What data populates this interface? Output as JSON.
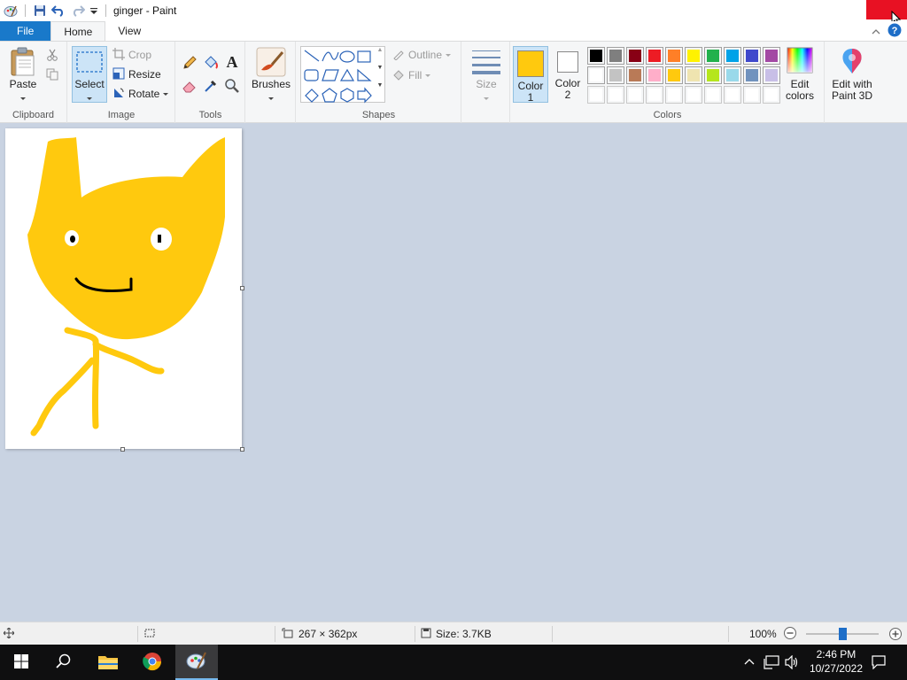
{
  "window": {
    "title": "ginger - Paint"
  },
  "tabs": [
    {
      "label": "File"
    },
    {
      "label": "Home"
    },
    {
      "label": "View"
    }
  ],
  "ribbon": {
    "clipboard": {
      "label": "Clipboard",
      "paste": "Paste"
    },
    "image": {
      "label": "Image",
      "select": "Select",
      "crop": "Crop",
      "resize": "Resize",
      "rotate": "Rotate"
    },
    "tools": {
      "label": "Tools"
    },
    "brushes": {
      "label": "Brushes"
    },
    "shapes": {
      "label": "Shapes",
      "outline": "Outline",
      "fill": "Fill"
    },
    "size": {
      "label": "Size"
    },
    "colors": {
      "label": "Colors",
      "color1": "Color 1",
      "color1_a": "Color",
      "color1_b": "1",
      "color2_a": "Color",
      "color2_b": "2",
      "color1_value": "#ffc90e",
      "color2_value": "#ffffff",
      "edit_a": "Edit",
      "edit_b": "colors",
      "paint3d_a": "Edit with",
      "paint3d_b": "Paint 3D",
      "palette_row1": [
        "#000000",
        "#7f7f7f",
        "#880015",
        "#ed1c24",
        "#ff7f27",
        "#fff200",
        "#22b14c",
        "#00a2e8",
        "#3f48cc",
        "#a349a4"
      ],
      "palette_row2": [
        "#ffffff",
        "#c3c3c3",
        "#b97a57",
        "#ffaec9",
        "#ffc90e",
        "#efe4b0",
        "#b5e61d",
        "#99d9ea",
        "#7092be",
        "#c8bfe7"
      ],
      "palette_row3": [
        "#ffffff",
        "#ffffff",
        "#ffffff",
        "#ffffff",
        "#ffffff",
        "#ffffff",
        "#ffffff",
        "#ffffff",
        "#ffffff",
        "#ffffff"
      ]
    }
  },
  "drawing": {
    "fill_color": "#ffc90e",
    "stroke_color": "#000000"
  },
  "status": {
    "dimensions": "267 × 362px",
    "size": "Size: 3.7KB",
    "zoom": "100%",
    "zoom_fraction": 0.5
  },
  "taskbar": {
    "time": "2:46 PM",
    "date": "10/27/2022"
  }
}
